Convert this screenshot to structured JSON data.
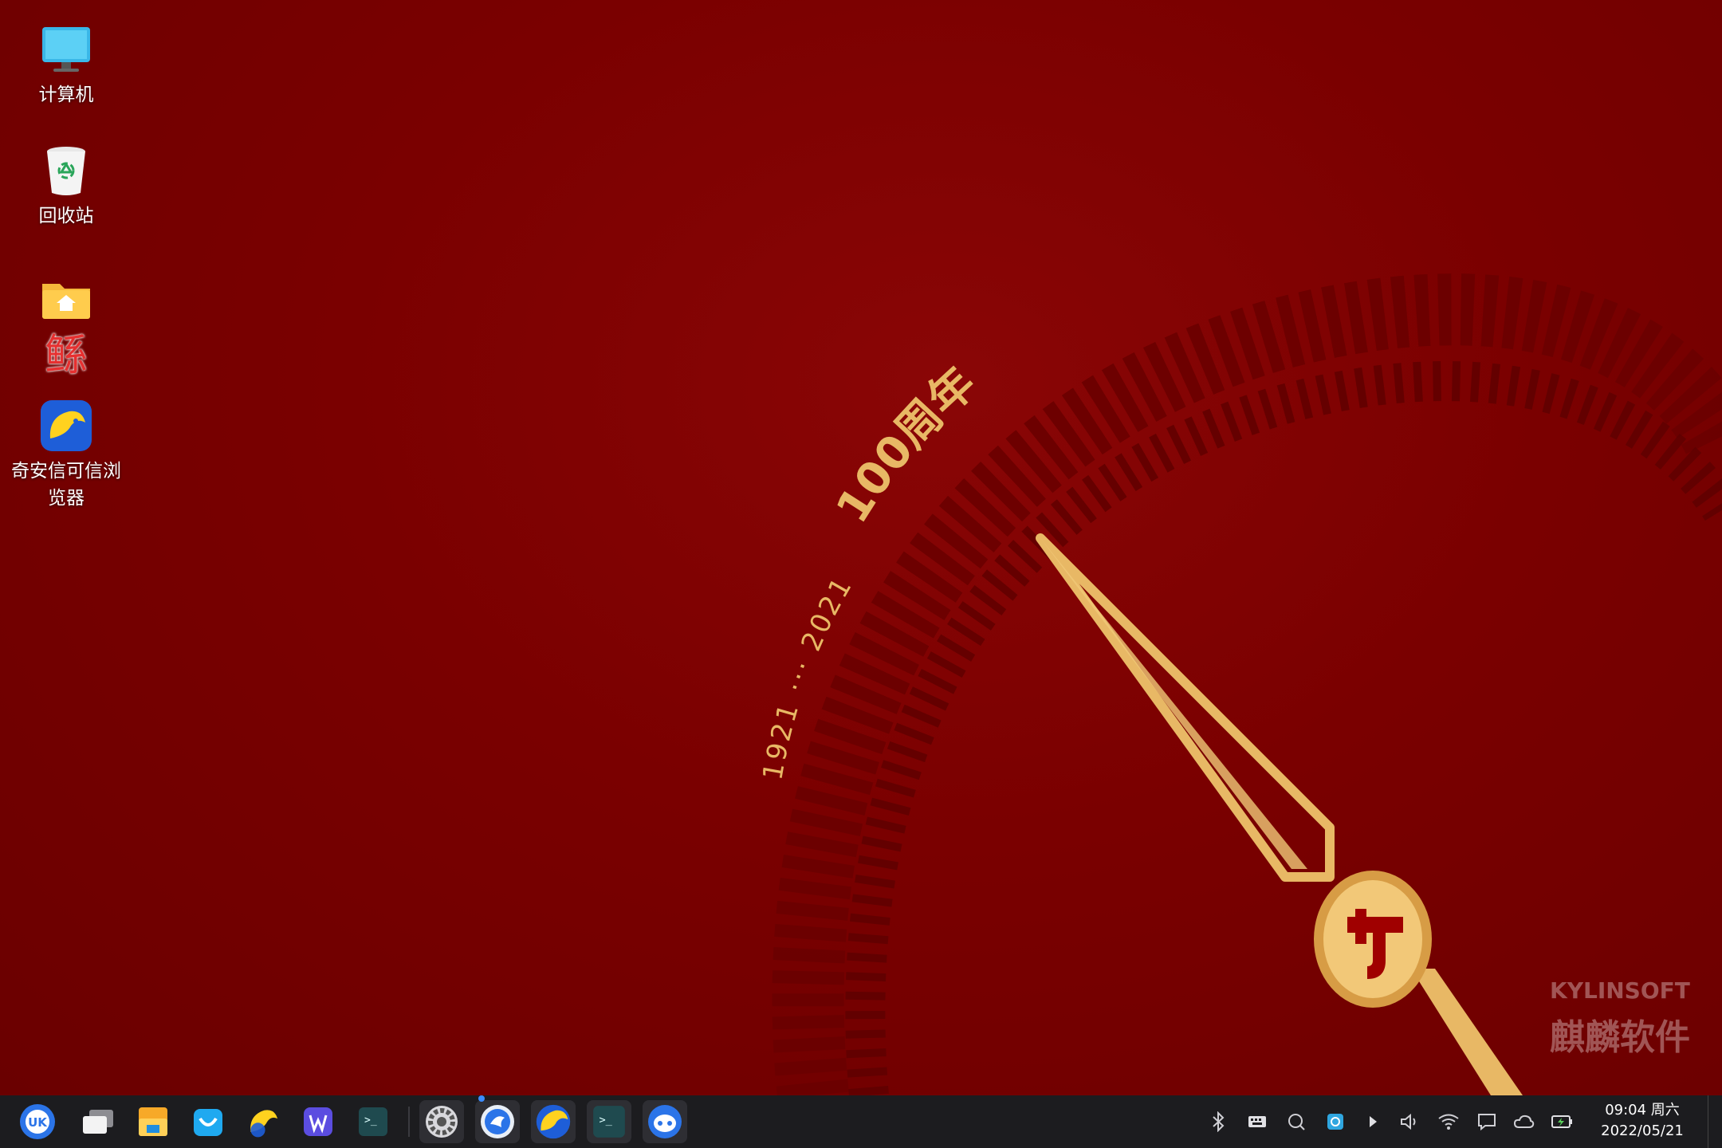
{
  "desktop": {
    "icons": [
      {
        "label": "计算机",
        "icon": "monitor-icon"
      },
      {
        "label": "回收站",
        "icon": "trash-icon"
      },
      {
        "label": "鲧",
        "icon": "home-folder-icon"
      },
      {
        "label": "奇安信可信浏览器",
        "icon": "browser-icon"
      }
    ]
  },
  "wallpaper": {
    "headline": "100周年",
    "years": "1921 ··· 2021",
    "brand_en": "KYLINSOFT",
    "brand_cn": "麒麟软件"
  },
  "taskbar": {
    "apps": [
      {
        "name": "start-menu",
        "icon": "kylin-start-icon"
      },
      {
        "name": "multitask-view",
        "icon": "multitask-icon"
      },
      {
        "name": "file-manager",
        "icon": "file-manager-icon"
      },
      {
        "name": "software-store",
        "icon": "shopping-bag-icon"
      },
      {
        "name": "browser",
        "icon": "browser-icon"
      },
      {
        "name": "wps-writer",
        "icon": "wps-icon"
      },
      {
        "name": "terminal",
        "icon": "terminal-icon"
      },
      {
        "name": "settings",
        "icon": "gear-icon"
      },
      {
        "name": "system-monitor",
        "icon": "bird-icon"
      },
      {
        "name": "browser-open",
        "icon": "browser-icon"
      },
      {
        "name": "terminal-open",
        "icon": "terminal-icon"
      },
      {
        "name": "assistant",
        "icon": "robot-icon"
      }
    ],
    "tray": [
      "bluetooth-icon",
      "keyboard-icon",
      "search-icon",
      "screenshot-icon",
      "arrow-right-icon",
      "volume-icon",
      "wifi-icon",
      "notification-icon",
      "cloud-icon",
      "battery-icon"
    ],
    "clock": {
      "time": "09:04 周六",
      "date": "2022/05/21"
    }
  },
  "colors": {
    "wallpaper": "#7a0000",
    "gold": "#e8b865",
    "taskbar": "#1c1c1f"
  }
}
